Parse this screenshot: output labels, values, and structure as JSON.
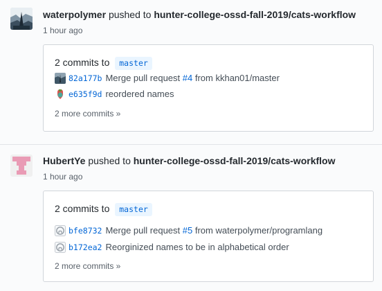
{
  "events": [
    {
      "actor": "waterpolymer",
      "action": "pushed to",
      "repo": "hunter-college-ossd-fall-2019/cats-workflow",
      "time": "1 hour ago",
      "commit_count_label": "2 commits to",
      "branch": "master",
      "commits": [
        {
          "sha": "82a177b",
          "message_before": "Merge pull request",
          "ref": "#4",
          "message_after": "from kkhan01/master"
        },
        {
          "sha": "e635f9d",
          "message_before": "reordered names",
          "ref": "",
          "message_after": ""
        }
      ],
      "more": "2 more commits »"
    },
    {
      "actor": "HubertYe",
      "action": "pushed to",
      "repo": "hunter-college-ossd-fall-2019/cats-workflow",
      "time": "1 hour ago",
      "commit_count_label": "2 commits to",
      "branch": "master",
      "commits": [
        {
          "sha": "bfe8732",
          "message_before": "Merge pull request",
          "ref": "#5",
          "message_after": "from waterpolymer/programlang"
        },
        {
          "sha": "b172ea2",
          "message_before": "Reorginized names to be in alphabetical order",
          "ref": "",
          "message_after": ""
        }
      ],
      "more": "2 more commits »"
    }
  ],
  "colors": {
    "link": "#0366d6",
    "branch_bg": "#eaf5ff",
    "identicon": "#e99bb5",
    "muted": "#586069"
  },
  "icons": {
    "event1_avatar": "waterpolymer-avatar-icon",
    "event2_avatar": "hubertye-identicon",
    "commit_default": "github-octocat-icon"
  }
}
